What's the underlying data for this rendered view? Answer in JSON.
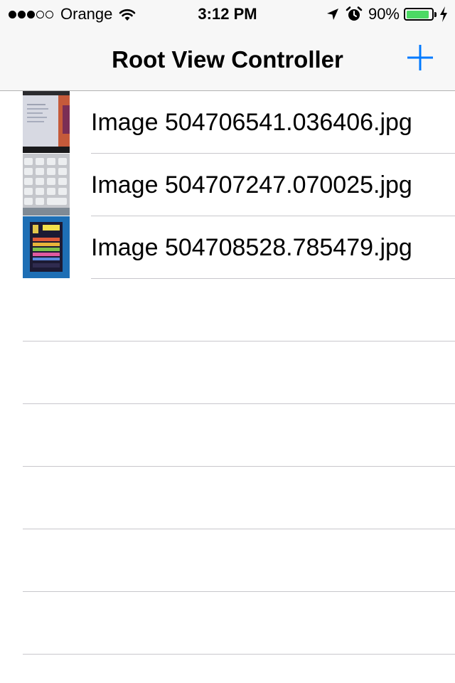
{
  "status_bar": {
    "signal_bars_filled": 3,
    "signal_bars_total": 5,
    "carrier": "Orange",
    "time": "3:12 PM",
    "battery_percent": "90%",
    "battery_level": 0.9,
    "battery_color": "#4cd964",
    "icons": [
      "wifi-icon",
      "location-arrow-icon",
      "alarm-icon",
      "battery-icon",
      "charging-bolt-icon"
    ]
  },
  "nav": {
    "title": "Root View Controller",
    "add_icon": "plus-icon",
    "tint_color": "#007aff"
  },
  "table": {
    "rows": [
      {
        "label": "Image 504706541.036406.jpg",
        "thumbnail": "laptop-screen-photo"
      },
      {
        "label": "Image 504707247.070025.jpg",
        "thumbnail": "keyboard-photo"
      },
      {
        "label": "Image 504708528.785479.jpg",
        "thumbnail": "card-on-blue-photo"
      }
    ],
    "empty_rows": 6
  }
}
